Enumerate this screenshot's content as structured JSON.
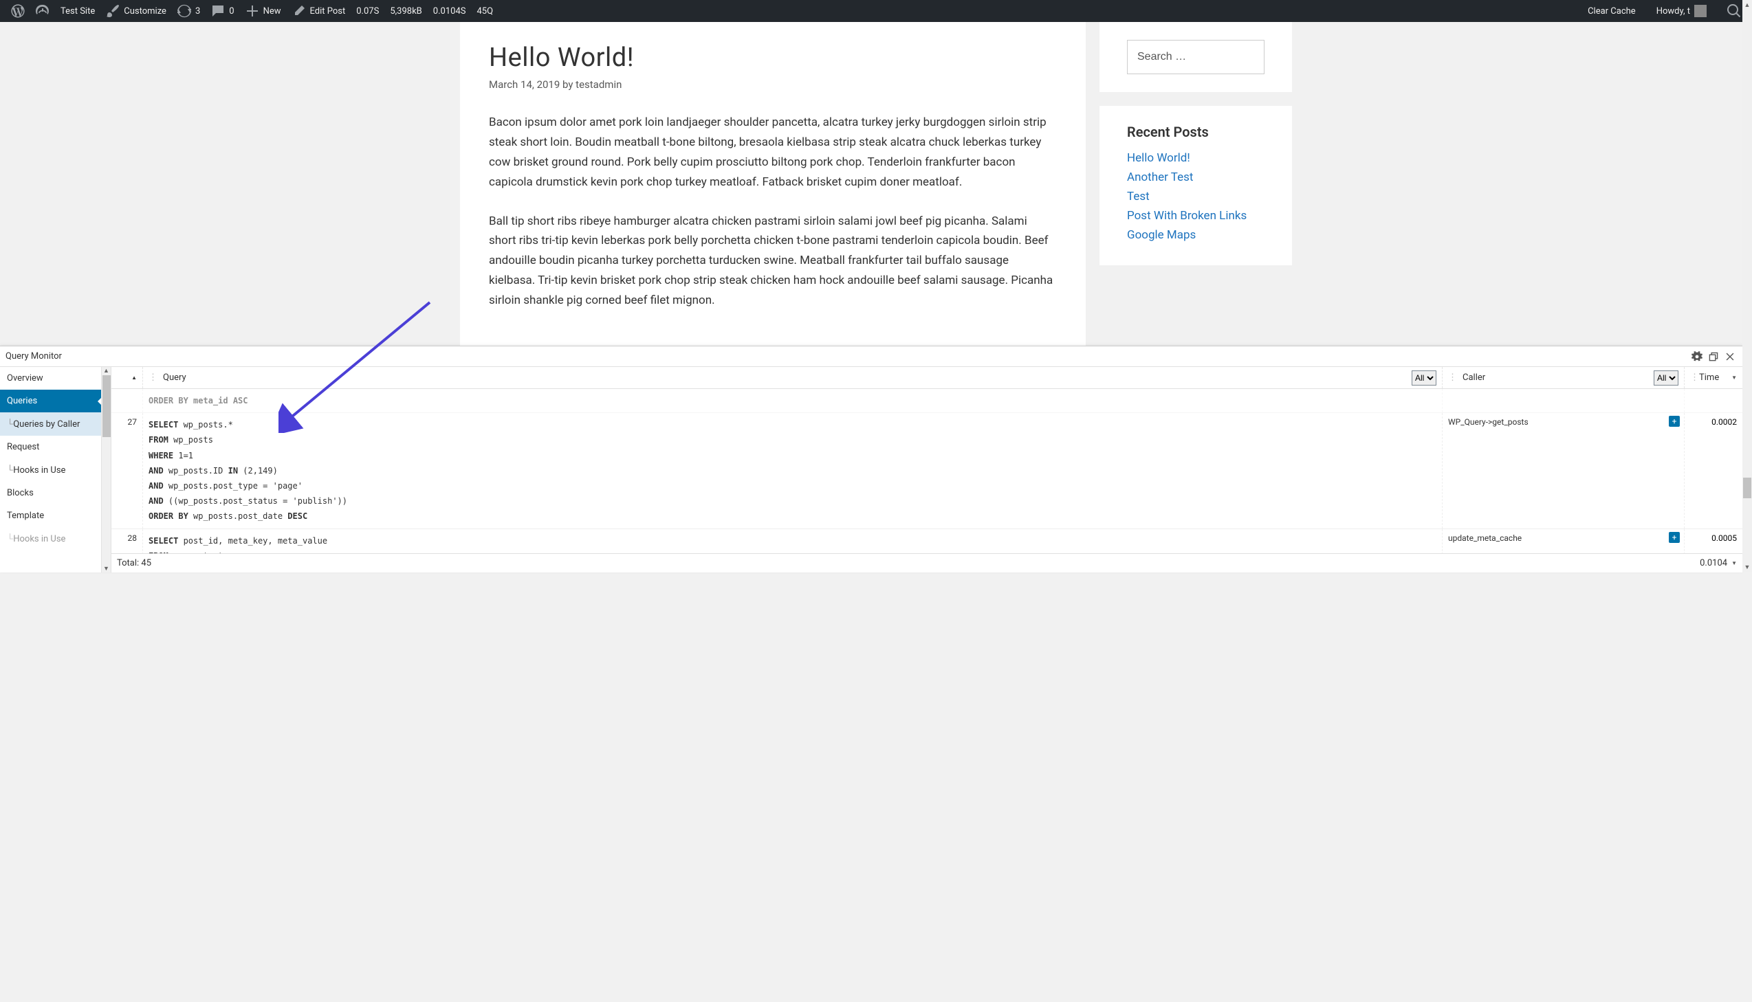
{
  "adminbar": {
    "site_name": "Test Site",
    "customize": "Customize",
    "updates_count": "3",
    "comments_count": "0",
    "new_label": "New",
    "edit_post": "Edit Post",
    "stat_time": "0.07S",
    "stat_mem": "5,398kB",
    "stat_db": "0.0104S",
    "stat_q": "45Q",
    "clear_cache": "Clear Cache",
    "howdy": "Howdy, t"
  },
  "post": {
    "title": "Hello World!",
    "meta": "March 14, 2019 by testadmin",
    "p1": "Bacon ipsum dolor amet pork loin landjaeger shoulder pancetta, alcatra turkey jerky burgdoggen sirloin strip steak short loin. Boudin meatball t-bone biltong, bresaola kielbasa strip steak alcatra chuck leberkas turkey cow brisket ground round. Pork belly cupim prosciutto biltong pork chop. Tenderloin frankfurter bacon capicola drumstick kevin pork chop turkey meatloaf. Fatback brisket cupim doner meatloaf.",
    "p2": "Ball tip short ribs ribeye hamburger alcatra chicken pastrami sirloin salami jowl beef pig picanha. Salami short ribs tri-tip kevin leberkas pork belly porchetta chicken t-bone pastrami tenderloin capicola boudin. Beef andouille boudin picanha turkey porchetta turducken swine. Meatball frankfurter tail buffalo sausage kielbasa. Tri-tip kevin brisket pork chop strip steak chicken ham hock andouille beef salami sausage. Picanha sirloin shankle pig corned beef filet mignon."
  },
  "search": {
    "placeholder": "Search …"
  },
  "recent_posts": {
    "title": "Recent Posts",
    "items": [
      "Hello World!",
      "Another Test",
      "Test",
      "Post With Broken Links",
      "Google Maps"
    ]
  },
  "qm": {
    "title": "Query Monitor",
    "nav": {
      "overview": "Overview",
      "queries": "Queries",
      "queries_by_caller": "Queries by Caller",
      "request": "Request",
      "hooks_in_use": "Hooks in Use",
      "blocks": "Blocks",
      "template": "Template",
      "hooks_in_use2": "Hooks in Use"
    },
    "head": {
      "query": "Query",
      "all1": "All",
      "caller": "Caller",
      "all2": "All",
      "time": "Time"
    },
    "rows": {
      "r0": {
        "sql_frag": "ORDER BY meta_id ASC"
      },
      "r27": {
        "num": "27",
        "sql": "SELECT wp_posts.*\nFROM wp_posts\nWHERE 1=1\nAND wp_posts.ID IN (2,149)\nAND wp_posts.post_type = 'page'\nAND ((wp_posts.post_status = 'publish'))\nORDER BY wp_posts.post_date DESC",
        "caller": "WP_Query->get_posts",
        "time": "0.0002"
      },
      "r28": {
        "num": "28",
        "sql": "SELECT post_id, meta_key, meta_value\nFROM wp_postmeta",
        "caller": "update_meta_cache",
        "time": "0.0005"
      }
    },
    "footer": {
      "total": "Total: 45",
      "time": "0.0104"
    }
  }
}
